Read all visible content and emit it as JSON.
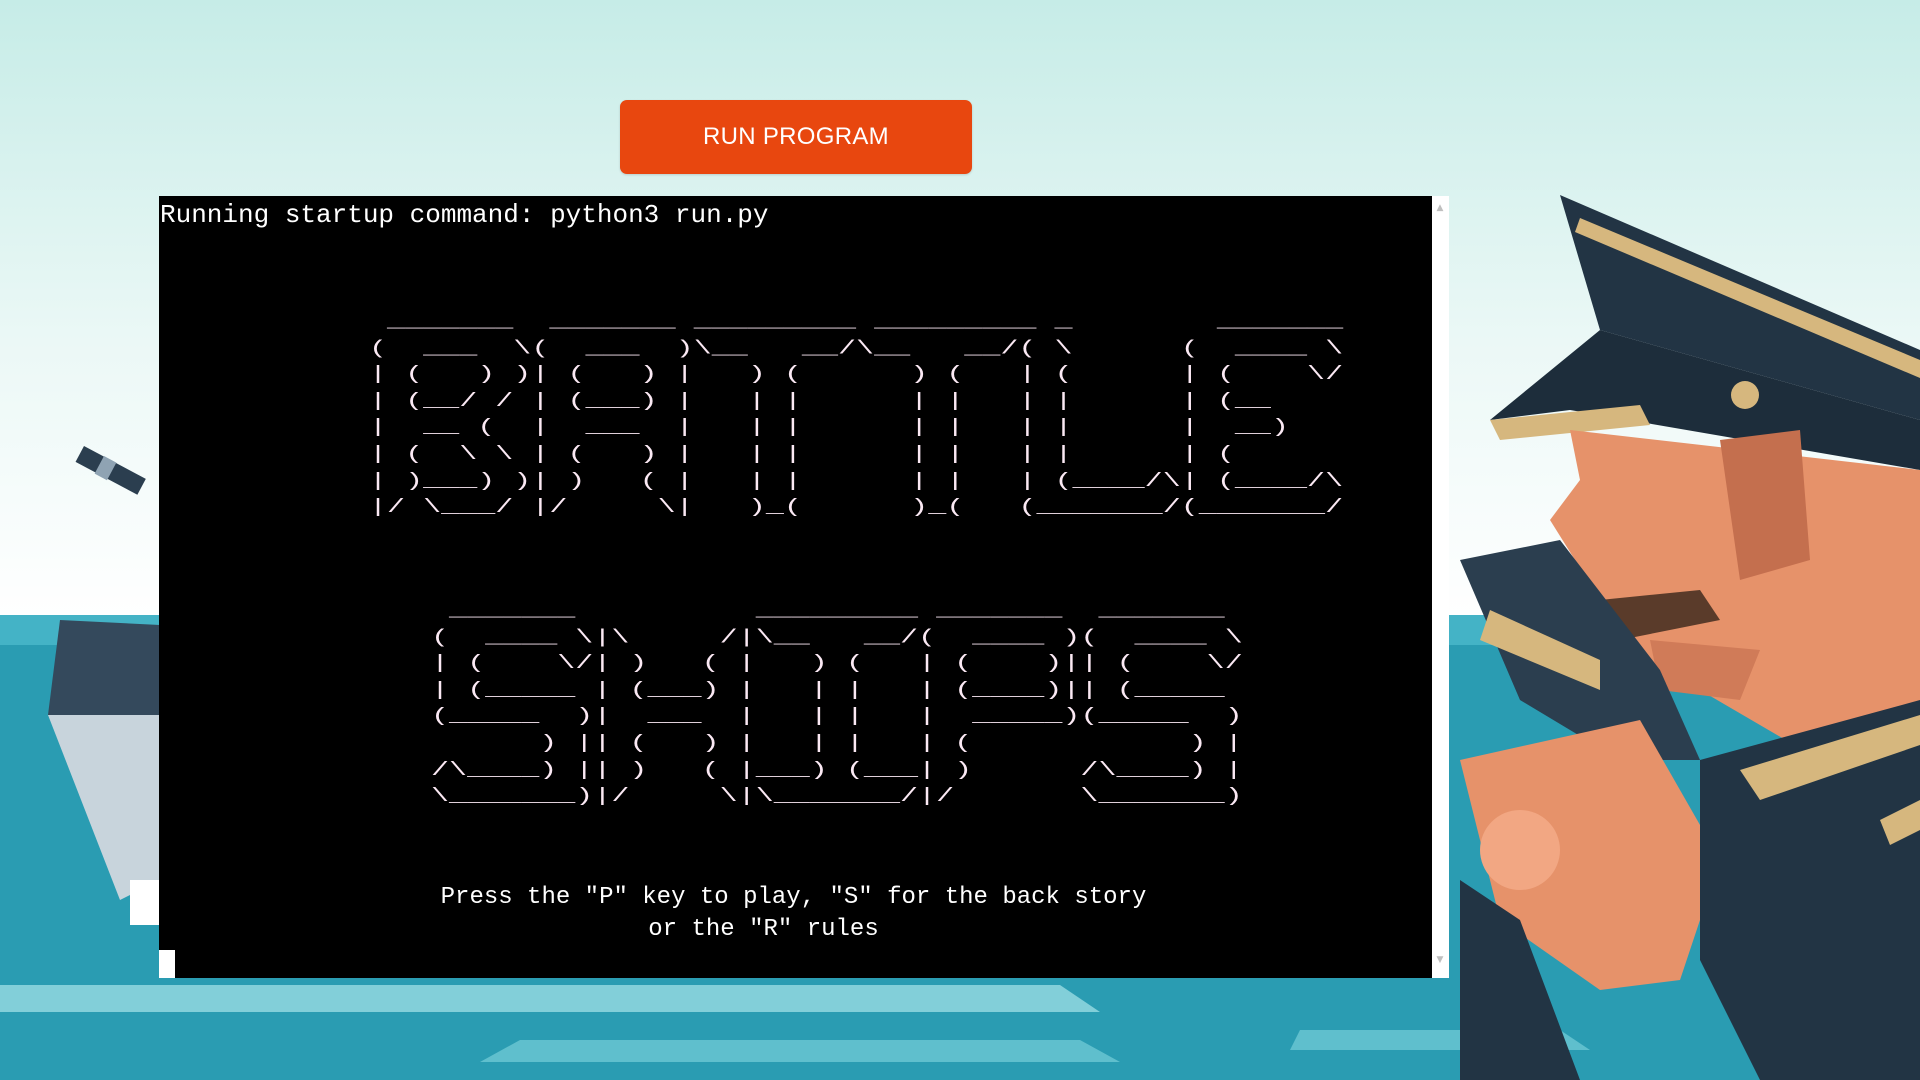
{
  "toolbar": {
    "run_label": "RUN PROGRAM"
  },
  "colors": {
    "accent": "#e8470f",
    "terminal_bg": "#000000",
    "sea": "#2a9cb2",
    "sky": "#c9ede9"
  },
  "terminal": {
    "startup_line": "Running startup command: python3 run.py",
    "ascii_battle": " _______  _______ _________ _________ _        _______ \n(  ___  \\(  ___  )\\__   __/\\__   __/( \\      (  ____ \\\n| (   ) )| (   ) |   ) (      ) (   | (      | (    \\/\n| (__/ / | (___) |   | |      | |   | |      | (__    \n|  __ (  |  ___  |   | |      | |   | |      |  __)   \n| (  \\ \\ | (   ) |   | |      | |   | |      | (      \n| )___) )| )   ( |   | |      | |   | (____/\\| (____/\\\n|/ \\___/ |/     \\|   )_(      )_(   (_______/(_______/",
    "ascii_ships": " _______          _________ _______  _______ \n(  ____ \\|\\     /|\\__   __/(  ____ )(  ____ \\\n| (    \\/| )   ( |   ) (   | (    )|| (    \\/\n| (_____ | (___) |   | |   | (____)|| (_____ \n(_____  )|  ___  |   | |   |  _____)(_____  )\n      ) || (   ) |   | |   | (            ) |\n/\\____) || )   ( |___) (___| )      /\\____) |\n\\_______)|/     \\|\\_______/|/       \\_______)",
    "prompt_line_1": "Press the \"P\" key to play, \"S\" for the back story",
    "prompt_line_2": "or the \"R\" rules"
  },
  "icons": {
    "scroll_up": "▲",
    "scroll_down": "▼"
  }
}
